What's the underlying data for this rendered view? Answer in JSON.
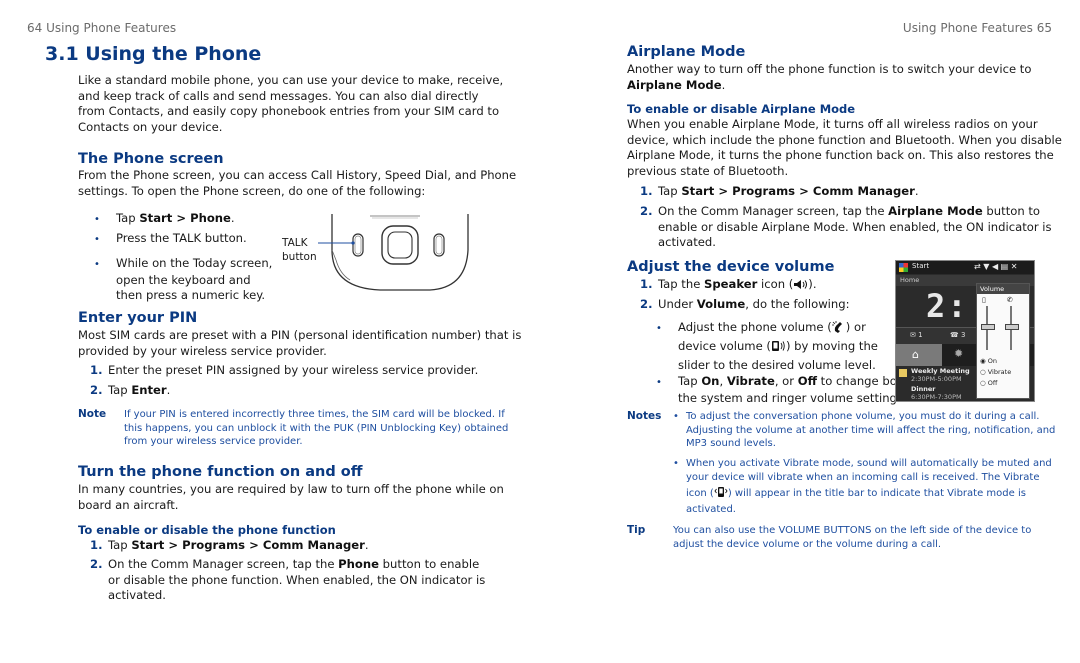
{
  "left_page": {
    "running_head": "64  Using Phone Features",
    "section_title": "3.1  Using the Phone",
    "intro": [
      "Like a standard mobile phone, you can use your device to make, receive,",
      "and keep track of calls and send messages. You can also dial directly",
      "from Contacts, and easily copy phonebook entries from your SIM card to",
      "Contacts on your device."
    ],
    "phone_screen": {
      "heading": "The Phone screen",
      "body": [
        "From the Phone screen, you can access Call History, Speed Dial, and Phone",
        "settings. To open the Phone screen, do one of the following:"
      ],
      "bullets": [
        {
          "pre": "Tap ",
          "bold": "Start > Phone",
          "post": "."
        },
        {
          "pre": "Press the TALK button.",
          "bold": "",
          "post": ""
        },
        {
          "lines": [
            "While on the Today screen,",
            "open the keyboard and",
            "then press a numeric key."
          ]
        }
      ],
      "figure": {
        "callout_line1": "TALK",
        "callout_line2": "button"
      }
    },
    "enter_pin": {
      "heading": "Enter your PIN",
      "body": [
        "Most SIM cards are preset with a PIN (personal identification number) that is",
        "provided by your wireless service provider."
      ],
      "steps": [
        {
          "n": "1.",
          "text": "Enter the preset PIN assigned by your wireless service provider."
        },
        {
          "n": "2.",
          "pre": "Tap ",
          "bold": "Enter",
          "post": "."
        }
      ],
      "note_label": "Note",
      "note": [
        "If your PIN is entered incorrectly three times, the SIM card will be blocked. If",
        "this happens, you can unblock it with the PUK (PIN Unblocking Key) obtained",
        "from your wireless service provider."
      ]
    },
    "phone_function": {
      "heading": "Turn the phone function on and off",
      "body": [
        "In many countries, you are required by law to turn off the phone while on",
        "board an aircraft."
      ],
      "subheading": "To enable or disable the phone function",
      "steps": [
        {
          "n": "1.",
          "pre": "Tap ",
          "bold": "Start > Programs > Comm Manager",
          "post": "."
        },
        {
          "n": "2.",
          "pre": "On the Comm Manager screen, tap the ",
          "bold": "Phone",
          "post": " button to enable",
          "cont": [
            "or disable the phone function. When enabled, the ON indicator is",
            "activated."
          ]
        }
      ]
    }
  },
  "right_page": {
    "running_head": "Using Phone Features  65",
    "airplane": {
      "heading": "Airplane Mode",
      "body_line1": "Another way to turn off the phone function is to switch your device to",
      "body_bold": "Airplane Mode",
      "subheading": "To enable or disable Airplane Mode",
      "body2": [
        "When you enable Airplane Mode, it turns off all wireless radios on your",
        "device, which include the phone function and Bluetooth. When you disable",
        "Airplane Mode, it turns the phone function back on. This also restores the",
        "previous state of Bluetooth."
      ],
      "steps": [
        {
          "n": "1.",
          "pre": "Tap ",
          "bold": "Start > Programs > Comm Manager",
          "post": "."
        },
        {
          "n": "2.",
          "pre": "On the Comm Manager screen, tap the ",
          "bold": "Airplane Mode",
          "post": " button to",
          "cont": [
            "enable or disable Airplane Mode.  When enabled, the ON indicator is",
            "activated."
          ]
        }
      ]
    },
    "volume": {
      "heading": "Adjust the device volume",
      "step1": {
        "n": "1.",
        "pre": "Tap the ",
        "bold": "Speaker",
        "post": " icon (",
        "icon": "speaker-icon",
        "end": ")."
      },
      "step2": {
        "n": "2.",
        "pre": "Under ",
        "bold": "Volume",
        "post": ", do the following:"
      },
      "bullet1": {
        "pre": "Adjust the phone volume (",
        "mid": ") or",
        "line2_pre": "device volume (",
        "line2_post": ") by moving the",
        "line3": "slider to the desired volume level."
      },
      "bullet2": {
        "pre": "Tap ",
        "b1": "On",
        "s1": ", ",
        "b2": "Vibrate",
        "s2": ", or ",
        "b3": "Off",
        "post": " to change both",
        "line2": "the system and ringer volume settings."
      },
      "screenshot": {
        "start_label": "Start",
        "home_label": "Home",
        "clock": "2:",
        "popup_title": "Volume",
        "radio_options": [
          "On",
          "Vibrate",
          "Off"
        ],
        "radio_selected": "On",
        "device_volume_level": 0.55,
        "phone_volume_level": 0.55,
        "appointments": [
          {
            "title": "Weekly Meeting",
            "time": "2:30PM-5:00PM"
          },
          {
            "title": "Dinner",
            "time": "6:30PM-7:30PM"
          }
        ],
        "tile_counts": [
          "1",
          "3"
        ]
      },
      "notes_label": "Notes",
      "notes": [
        [
          "To adjust the conversation phone volume, you must do it during a call.",
          "Adjusting the volume at another time will affect the ring, notification, and",
          "MP3 sound levels."
        ],
        [
          "When you activate Vibrate mode, sound will automatically be muted and",
          "your device will vibrate when an incoming call is received. The Vibrate"
        ]
      ],
      "note2_line3_pre": "icon (",
      "note2_line3_post": ") will appear in the title bar to indicate that Vibrate mode is",
      "note2_line4": "activated.",
      "tip_label": "Tip",
      "tip": [
        "You can also use the VOLUME BUTTONS on the left side of the device to",
        "adjust the device volume or the volume during a call."
      ]
    }
  }
}
